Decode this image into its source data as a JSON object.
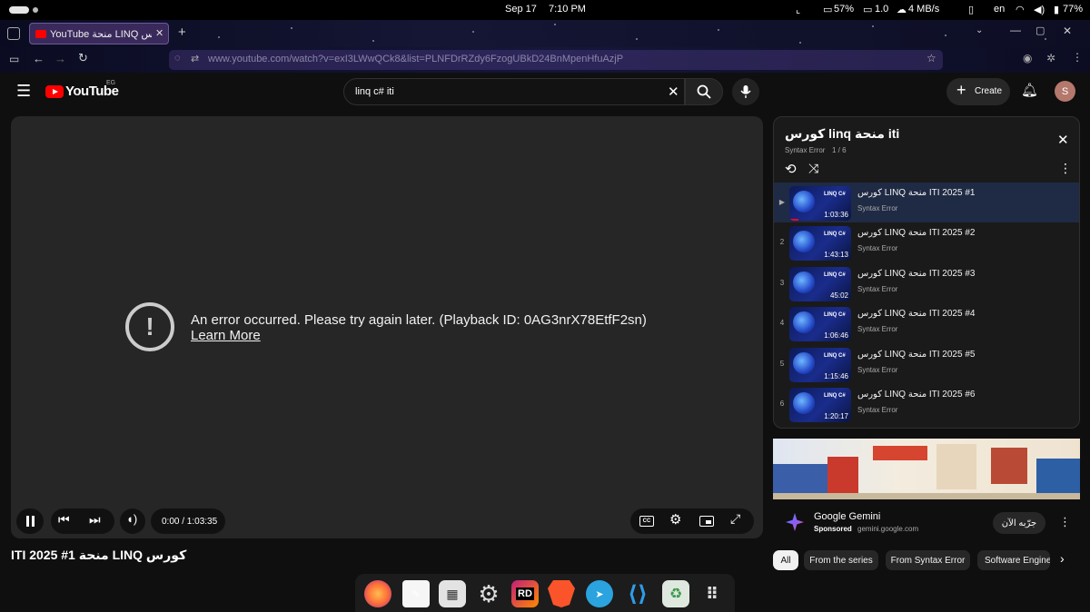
{
  "status_bar": {
    "date": "Sep 17",
    "time": "7:10 PM",
    "cpu": "57%",
    "mem": "1.0",
    "net": "4 MB/s",
    "lang": "en",
    "battery": "77%"
  },
  "browser": {
    "tab_title": "YouTube منحة LINQ كورس",
    "new_tab": "+",
    "url": "www.youtube.com/watch?v=exI3LWwQCk8&list=PLNFDrRZdy6FzogUBkD24BnMpenHfuAzjP"
  },
  "header": {
    "logo_text": "YouTube",
    "country": "EG",
    "search_value": "linq c# iti",
    "create_label": "Create",
    "avatar_letter": "S"
  },
  "player": {
    "error_message": "An error occurred. Please try again later. (Playback ID: 0AG3nrX78EtfF2sn)",
    "learn_more": "Learn More",
    "time_display": "0:00 / 1:03:35",
    "video_title": "كورس LINQ منحة ITI 2025 #1"
  },
  "playlist": {
    "title": "كورس linq منحة iti",
    "channel": "Syntax Error",
    "position": "1 / 6",
    "items": [
      {
        "index": "▶",
        "title": "كورس LINQ منحة ITI 2025 #1",
        "channel": "Syntax Error",
        "duration": "1:03:36",
        "thumb_label": "LINQ C#"
      },
      {
        "index": "2",
        "title": "كورس LINQ منحة ITI 2025 #2",
        "channel": "Syntax Error",
        "duration": "1:43:13",
        "thumb_label": "LINQ C#"
      },
      {
        "index": "3",
        "title": "كورس LINQ منحة ITI 2025 #3",
        "channel": "Syntax Error",
        "duration": "45:02",
        "thumb_label": "LINQ C#"
      },
      {
        "index": "4",
        "title": "كورس LINQ منحة ITI 2025 #4",
        "channel": "Syntax Error",
        "duration": "1:06:46",
        "thumb_label": "LINQ C#"
      },
      {
        "index": "5",
        "title": "كورس LINQ منحة ITI 2025 #5",
        "channel": "Syntax Error",
        "duration": "1:15:46",
        "thumb_label": "LINQ C#"
      },
      {
        "index": "6",
        "title": "كورس LINQ منحة ITI 2025 #6",
        "channel": "Syntax Error",
        "duration": "1:20:17",
        "thumb_label": "LINQ C#"
      }
    ]
  },
  "ad": {
    "advertiser": "Google Gemini",
    "sponsored": "Sponsored",
    "domain": "gemini.google.com",
    "cta": "جرّبه الآن"
  },
  "chips": [
    "All",
    "From the series",
    "From Syntax Error",
    "Software Engine"
  ],
  "dock": {
    "rd_label": "RD"
  },
  "colors": {
    "youtube_red": "#ff0000",
    "active_row": "#1f2a44",
    "progress_red": "#ff0033",
    "tab_active": "#3a2a5c"
  }
}
